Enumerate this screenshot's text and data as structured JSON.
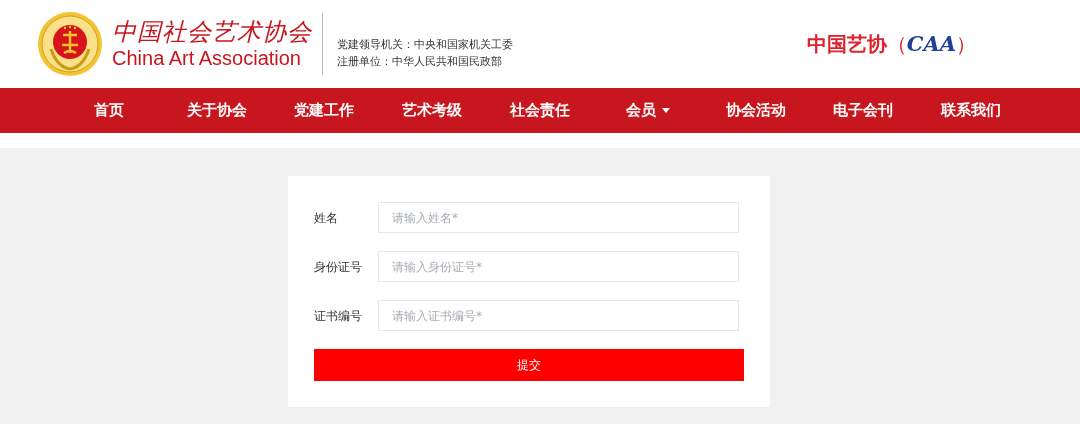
{
  "logo": {
    "calligraphy": "中国社会艺术协会",
    "english": "China Art Association"
  },
  "header_info": [
    "党建领导机关：中央和国家机关工委",
    "注册单位：中华人民共和国民政部"
  ],
  "brand": {
    "chinese": "中国艺协",
    "open": "（",
    "abbr": "CAA",
    "close": "）"
  },
  "nav": [
    {
      "label": "首页",
      "dropdown": false
    },
    {
      "label": "关于协会",
      "dropdown": false
    },
    {
      "label": "党建工作",
      "dropdown": false
    },
    {
      "label": "艺术考级",
      "dropdown": false
    },
    {
      "label": "社会责任",
      "dropdown": false
    },
    {
      "label": "会员",
      "dropdown": true
    },
    {
      "label": "协会活动",
      "dropdown": false
    },
    {
      "label": "电子会刊",
      "dropdown": false
    },
    {
      "label": "联系我们",
      "dropdown": false
    }
  ],
  "form": {
    "fields": [
      {
        "label": "姓名",
        "placeholder": "请输入姓名*"
      },
      {
        "label": "身份证号",
        "placeholder": "请输入身份证号*"
      },
      {
        "label": "证书编号",
        "placeholder": "请输入证书编号*"
      }
    ],
    "submit": "提交"
  }
}
